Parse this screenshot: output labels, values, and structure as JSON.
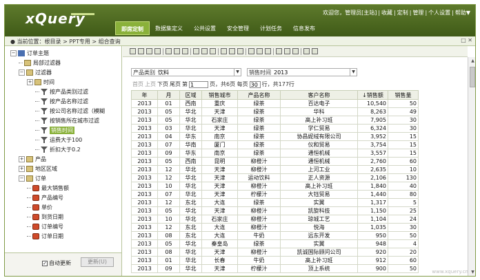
{
  "app": {
    "logo": "xQuery"
  },
  "toplinks": [
    "欢迎您，管理员[主站]",
    "|",
    "收藏",
    "|",
    "定制",
    "|",
    "管理",
    "|",
    "个人设置",
    "|",
    "帮助▼"
  ],
  "nav": {
    "tabs": [
      "即席定制",
      "数据集定义",
      "公共设置",
      "安全管理",
      "计划任务",
      "信息发布"
    ],
    "active": 0
  },
  "breadcrumb": {
    "text": "当前位置：根目录 > PPT专用 > 组合查询",
    "win_icons": "□ ✕"
  },
  "tree": {
    "items": [
      {
        "label": "订单主题",
        "level": 0,
        "exp": "−",
        "icon": "root"
      },
      {
        "label": "局部过滤器",
        "level": 1,
        "exp": "",
        "icon": "folder"
      },
      {
        "label": "过滤器",
        "level": 1,
        "exp": "−",
        "icon": "folder"
      },
      {
        "label": "时间",
        "level": 2,
        "exp": "+",
        "icon": "folder"
      },
      {
        "label": "按产品类别过滤",
        "level": 3,
        "exp": "",
        "icon": "filter"
      },
      {
        "label": "按产品名称过滤",
        "level": 3,
        "exp": "",
        "icon": "filter"
      },
      {
        "label": "按公司名称过滤（模糊",
        "level": 3,
        "exp": "",
        "icon": "filter"
      },
      {
        "label": "按销售所在城市过滤",
        "level": 3,
        "exp": "",
        "icon": "filter"
      },
      {
        "label": "销售时间",
        "level": 3,
        "exp": "",
        "icon": "filter",
        "selected": true
      },
      {
        "label": "运费大于100",
        "level": 3,
        "exp": "",
        "icon": "filter"
      },
      {
        "label": "折扣大于0.2",
        "level": 3,
        "exp": "",
        "icon": "filter"
      },
      {
        "label": "产品",
        "level": 1,
        "exp": "+",
        "icon": "folder"
      },
      {
        "label": "地区区域",
        "level": 1,
        "exp": "+",
        "icon": "folder"
      },
      {
        "label": "订单",
        "level": 1,
        "exp": "−",
        "icon": "folder"
      },
      {
        "label": "最大销售额",
        "level": 2,
        "exp": "",
        "icon": "field"
      },
      {
        "label": "产品编号",
        "level": 2,
        "exp": "",
        "icon": "field"
      },
      {
        "label": "单价",
        "level": 2,
        "exp": "",
        "icon": "field"
      },
      {
        "label": "到货日期",
        "level": 2,
        "exp": "",
        "icon": "field"
      },
      {
        "label": "订单编号",
        "level": 2,
        "exp": "",
        "icon": "field"
      },
      {
        "label": "订单日期",
        "level": 2,
        "exp": "",
        "icon": "field"
      }
    ],
    "auto_update": "自动更新",
    "update_button": "更新(U)"
  },
  "filters": {
    "category": {
      "label": "产品类别",
      "value": "饮料"
    },
    "time": {
      "label": "销售时间",
      "value": "2013"
    }
  },
  "pager": {
    "first": "首页",
    "prev": "上页",
    "next": "下页",
    "last": "尾页",
    "page_pre": "第",
    "page_value": "1",
    "page_post": "页，共6页 每页",
    "per_page": "30",
    "per_post": "行，共177行"
  },
  "table": {
    "columns": [
      "年",
      "月",
      "区域",
      "销售城市",
      "产品名称",
      "客户名称",
      "↓销售额",
      "销售量"
    ],
    "rows": [
      [
        "2013",
        "01",
        "西南",
        "重庆",
        "绿茶",
        "百达电子",
        "10,540",
        "50"
      ],
      [
        "2013",
        "05",
        "华北",
        "天津",
        "绿茶",
        "华科",
        "8,263",
        "49"
      ],
      [
        "2013",
        "05",
        "华北",
        "石家庄",
        "绿茶",
        "高上补习班",
        "7,905",
        "30"
      ],
      [
        "2013",
        "03",
        "华北",
        "天津",
        "绿茶",
        "学仁贸易",
        "6,324",
        "30"
      ],
      [
        "2013",
        "04",
        "华东",
        "南京",
        "绿茶",
        "协昌妮绒有限公司",
        "3,952",
        "15"
      ],
      [
        "2013",
        "07",
        "华南",
        "厦门",
        "绿茶",
        "仪和贸易",
        "3,754",
        "15"
      ],
      [
        "2013",
        "09",
        "华东",
        "南京",
        "绿茶",
        "通恒机械",
        "3,557",
        "15"
      ],
      [
        "2013",
        "05",
        "西南",
        "昆明",
        "柳橙汁",
        "通恒机械",
        "2,760",
        "60"
      ],
      [
        "2013",
        "12",
        "华北",
        "天津",
        "柳橙汁",
        "上河工业",
        "2,635",
        "10"
      ],
      [
        "2013",
        "12",
        "华北",
        "天津",
        "运动饮料",
        "正人资源",
        "2,106",
        "130"
      ],
      [
        "2013",
        "10",
        "华北",
        "天津",
        "柳橙汁",
        "高上补习班",
        "1,840",
        "40"
      ],
      [
        "2013",
        "07",
        "华北",
        "天津",
        "柠檬汁",
        "大钰贸易",
        "1,440",
        "80"
      ],
      [
        "2013",
        "12",
        "东北",
        "大连",
        "绿茶",
        "实翼",
        "1,317",
        "5"
      ],
      [
        "2013",
        "05",
        "华北",
        "天津",
        "柳橙汁",
        "凯旋科技",
        "1,150",
        "25"
      ],
      [
        "2013",
        "10",
        "华北",
        "石家庄",
        "柳橙汁",
        "琼城工艺",
        "1,104",
        "24"
      ],
      [
        "2013",
        "12",
        "东北",
        "大连",
        "柳橙汁",
        "悦海",
        "1,035",
        "30"
      ],
      [
        "2013",
        "08",
        "东北",
        "大连",
        "牛奶",
        "远东开发",
        "950",
        "50"
      ],
      [
        "2013",
        "05",
        "华北",
        "秦皇岛",
        "绿茶",
        "实翼",
        "948",
        "4"
      ],
      [
        "2013",
        "08",
        "华北",
        "天津",
        "柳橙汁",
        "凯诚国际顾问公司",
        "920",
        "20"
      ],
      [
        "2013",
        "01",
        "华北",
        "长春",
        "牛奶",
        "高上补习班",
        "912",
        "60"
      ],
      [
        "2013",
        "09",
        "华北",
        "天津",
        "柠檬汁",
        "顶上系统",
        "900",
        "50"
      ]
    ]
  },
  "watermark": "www.xquery.cn"
}
